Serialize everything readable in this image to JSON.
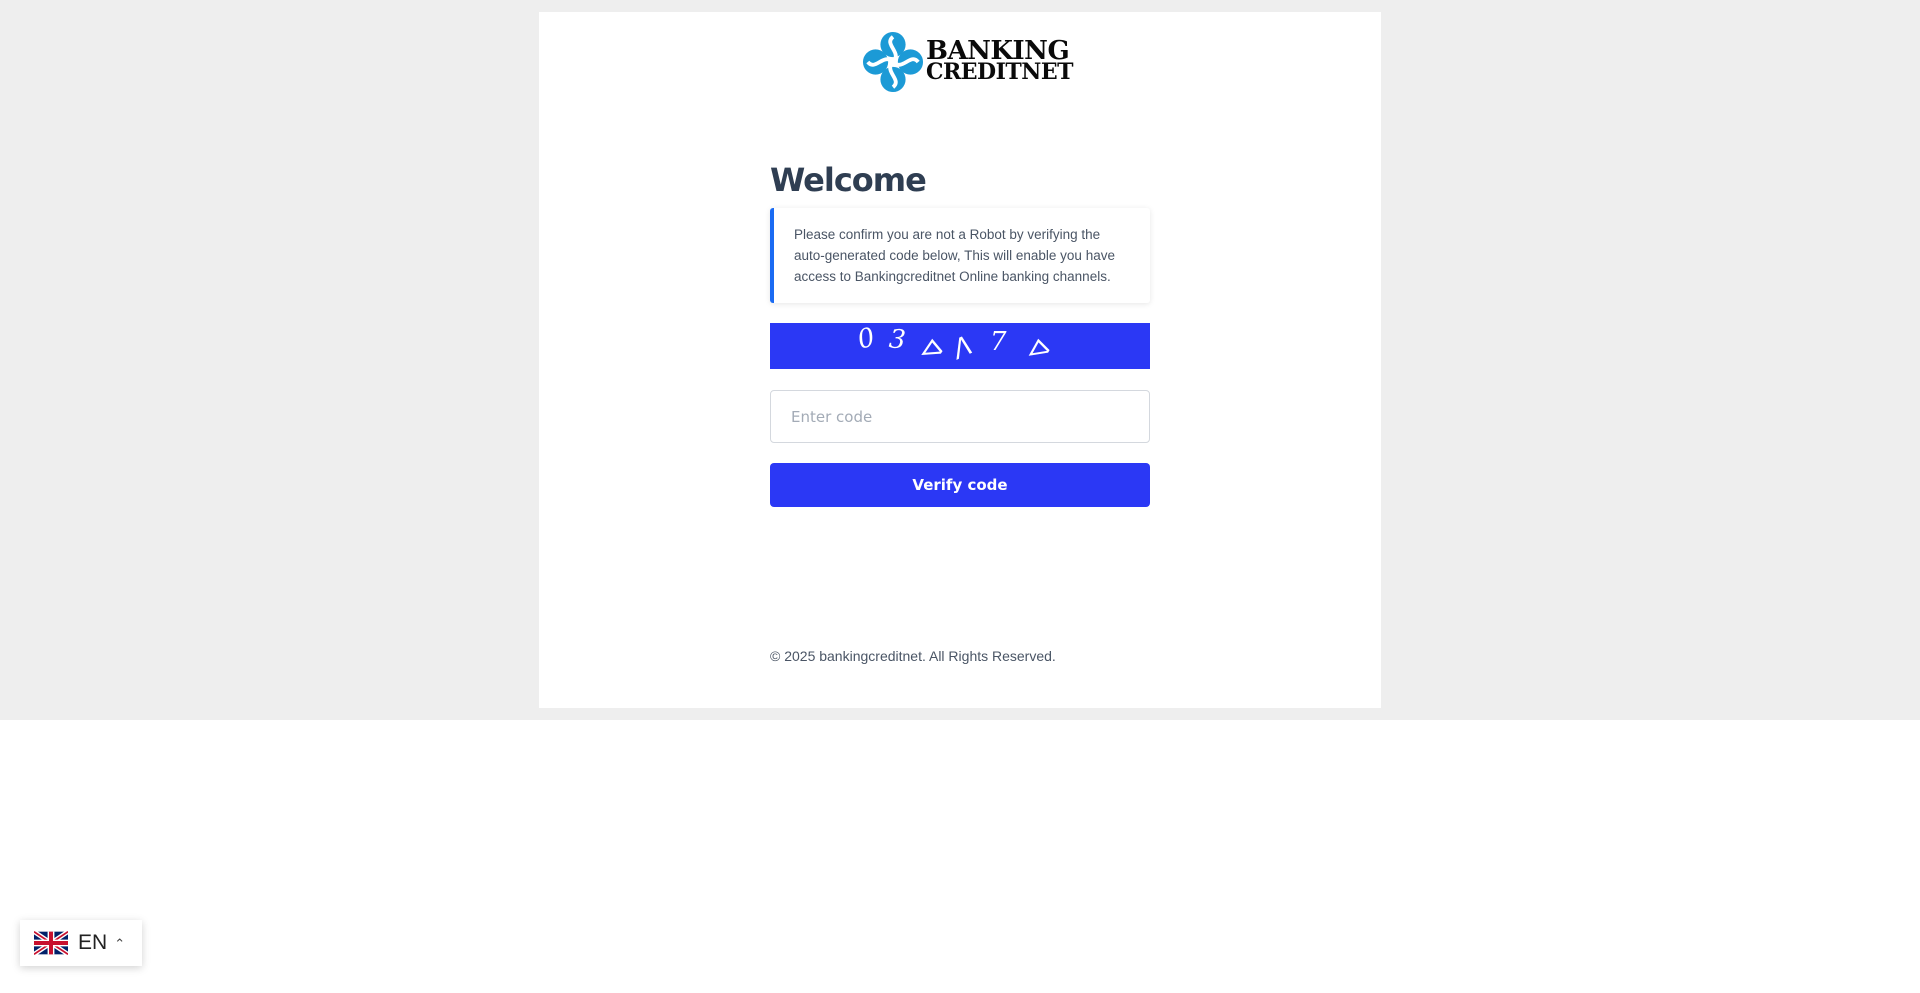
{
  "brand": {
    "line1": "BANKING",
    "line2": "CREDITNET"
  },
  "main": {
    "title": "Welcome",
    "notice": "Please confirm you are not a Robot by verifying the auto-generated code below, This will enable you have access to Bankingcreditnet Online banking channels.",
    "captcha_chars": [
      "0",
      "3",
      "ᐅ",
      "ᐱ",
      "7",
      "ᐅ"
    ],
    "captcha_bg": "#2b38f5",
    "code_placeholder": "Enter code",
    "code_value": "",
    "verify_label": "Verify code"
  },
  "footer": {
    "copyright": "© 2025 bankingcreditnet. All Rights Reserved."
  },
  "language": {
    "code": "EN",
    "flag": "uk-flag-icon"
  },
  "colors": {
    "accent": "#2b38f5",
    "notice_border": "#1a6bf3",
    "title": "#2f3e52",
    "logo_blue": "#1c9ad6"
  }
}
